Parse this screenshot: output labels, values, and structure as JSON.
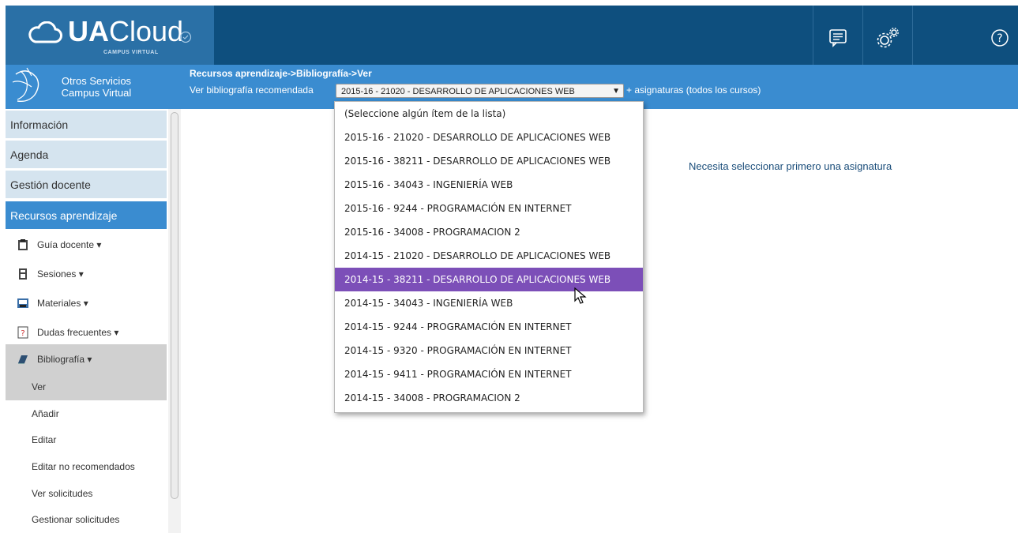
{
  "header": {
    "logo_bold": "UA",
    "logo_light": "Cloud",
    "logo_sub": "CAMPUS VIRTUAL",
    "icons": [
      "chat-icon",
      "settings-icon",
      "help-icon"
    ],
    "bar_color": "#0e4f7e",
    "accent_color": "#3a8cd0"
  },
  "services": {
    "line1": "Otros Servicios",
    "line2": "Campus Virtual"
  },
  "breadcrumb": "Recursos aprendizaje->Bibliografía->Ver",
  "filter": {
    "label": "Ver bibliografía recomendada",
    "selected": "2015-16 - 21020 - DESARROLLO DE APLICACIONES WEB",
    "more_link": "+ asignaturas (todos los cursos)"
  },
  "dropdown": {
    "options": [
      "(Seleccione algún ítem de la lista)",
      "2015-16 - 21020 - DESARROLLO DE APLICACIONES WEB",
      "2015-16 - 38211 - DESARROLLO DE APLICACIONES WEB",
      "2015-16 - 34043 - INGENIERÍA WEB",
      "2015-16 - 9244 - PROGRAMACIÓN EN INTERNET",
      "2015-16 - 34008 - PROGRAMACION 2",
      "2014-15 - 21020 - DESARROLLO DE APLICACIONES WEB",
      "2014-15 - 38211 - DESARROLLO DE APLICACIONES WEB",
      "2014-15 - 34043 - INGENIERÍA WEB",
      "2014-15 - 9244 - PROGRAMACIÓN EN INTERNET",
      "2014-15 - 9320 - PROGRAMACIÓN EN INTERNET",
      "2014-15 - 9411 - PROGRAMACIÓN EN INTERNET",
      "2014-15 - 34008 - PROGRAMACION 2"
    ],
    "highlighted": "2014-15 - 38211 - DESARROLLO DE APLICACIONES WEB",
    "highlight_color": "#7c4fb8"
  },
  "message": "Necesita seleccionar primero una asignatura",
  "sidebar": {
    "main": [
      "Información",
      "Agenda",
      "Gestión docente",
      "Recursos aprendizaje"
    ],
    "sub": [
      "Guía docente ▾",
      "Sesiones ▾",
      "Materiales ▾",
      "Dudas frecuentes ▾",
      "Bibliografía ▾"
    ],
    "leaves": [
      "Ver",
      "Añadir",
      "Editar",
      "Editar no recomendados",
      "Ver solicitudes",
      "Gestionar solicitudes"
    ]
  }
}
